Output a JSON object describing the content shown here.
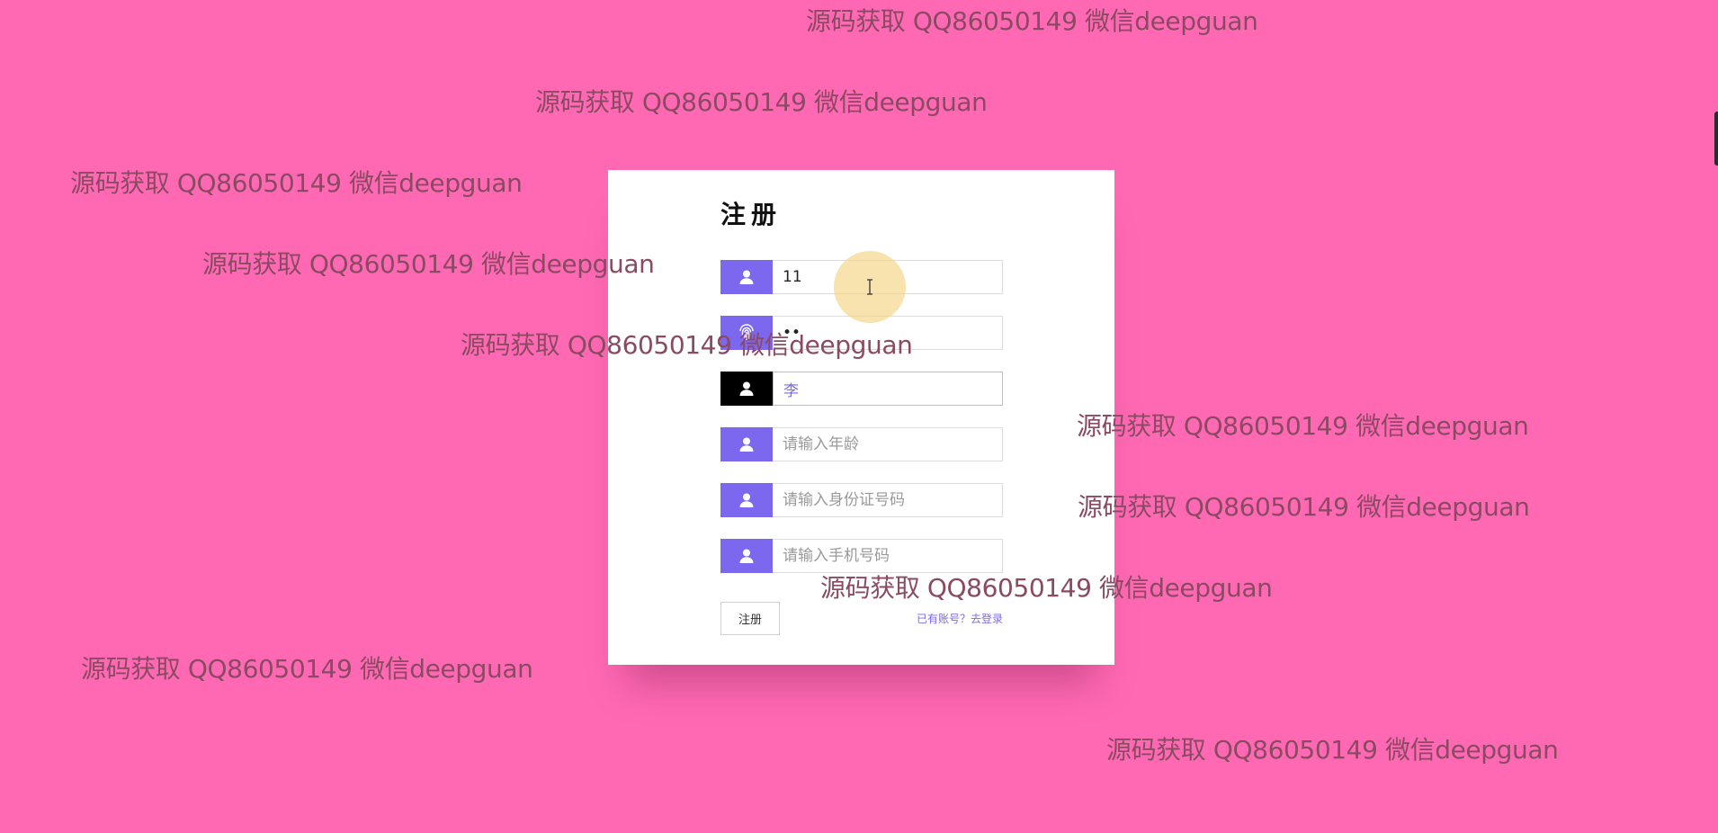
{
  "form": {
    "title": "注册",
    "fields": [
      {
        "icon": "user-icon",
        "value": "11",
        "placeholder": ""
      },
      {
        "icon": "fingerprint-icon",
        "value": "..",
        "placeholder": ""
      },
      {
        "icon": "user-icon",
        "value": "李",
        "placeholder": ""
      },
      {
        "icon": "user-icon",
        "value": "",
        "placeholder": "请输入年龄"
      },
      {
        "icon": "user-icon",
        "value": "",
        "placeholder": "请输入身份证号码"
      },
      {
        "icon": "user-icon",
        "value": "",
        "placeholder": "请输入手机号码"
      }
    ],
    "submit_label": "注册",
    "login_link": "已有账号？去登录"
  },
  "watermark": {
    "text": "源码获取 QQ86050149 微信deepguan"
  },
  "colors": {
    "background": "#ff69b4",
    "accent": "#7b68ee",
    "active_icon": "#000000",
    "watermark": "#8a4a62"
  }
}
